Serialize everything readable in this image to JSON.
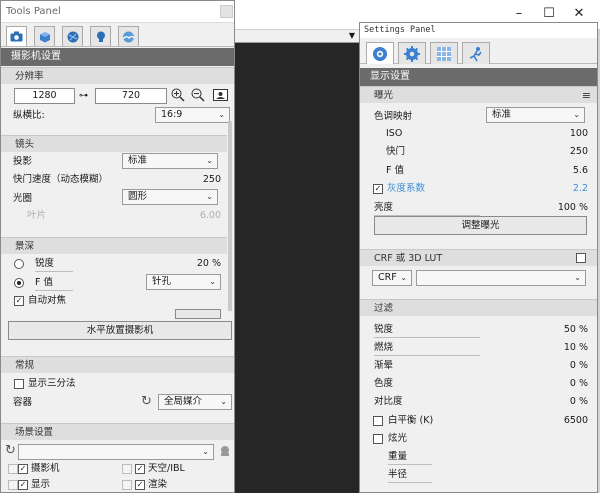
{
  "left_panel": {
    "title": "Tools Panel",
    "section_title": "摄影机设置",
    "resolution": {
      "heading": "分辨率",
      "width": "1280",
      "height": "720",
      "aspect_label": "纵横比:",
      "aspect_value": "16:9"
    },
    "lens": {
      "heading": "镜头",
      "projection_label": "投影",
      "projection_value": "标准",
      "shutter_label": "快门速度（动态模糊）",
      "shutter_value": "250",
      "aperture_label": "光圈",
      "aperture_value": "圆形",
      "blades_label": "叶片",
      "blades_value": "6.00"
    },
    "dof": {
      "heading": "景深",
      "sharpness_label": "锐度",
      "sharpness_value": "20 %",
      "fstop_label": "F 值",
      "fstop_value": "针孔",
      "autofocus_label": "自动对焦",
      "level_button": "水平放置摄影机"
    },
    "general": {
      "heading": "常规",
      "thirds_label": "显示三分法",
      "container_label": "容器",
      "container_value": "全局媒介"
    },
    "scene": {
      "heading": "场景设置",
      "camera_label": "摄影机",
      "sky_label": "天空/IBL",
      "display_label": "显示",
      "render_label": "渲染"
    }
  },
  "right_panel": {
    "title": "Settings Panel",
    "section_title": "显示设置",
    "exposure": {
      "heading": "曝光",
      "tonemap_label": "色调映射",
      "tonemap_value": "标准",
      "iso_label": "ISO",
      "iso_value": "100",
      "shutter_label": "快门",
      "shutter_value": "250",
      "fstop_label": "F 值",
      "fstop_value": "5.6",
      "gamma_label": "灰度系数",
      "gamma_value": "2.2",
      "brightness_label": "亮度",
      "brightness_value": "100 %",
      "adjust_button": "调整曝光"
    },
    "crf": {
      "heading": "CRF 或 3D LUT",
      "select_value": "CRF"
    },
    "filter": {
      "heading": "过滤",
      "sharpness_label": "锐度",
      "sharpness_value": "50 %",
      "burn_label": "燃烧",
      "burn_value": "10 %",
      "vignette_label": "渐晕",
      "vignette_value": "0 %",
      "saturation_label": "色度",
      "saturation_value": "0 %",
      "contrast_label": "对比度",
      "contrast_value": "0 %",
      "wb_label": "白平衡 (K)",
      "wb_value": "6500",
      "glare_label": "炫光",
      "intensity_label": "重量",
      "radius_label": "半径"
    }
  },
  "colors": {
    "section_bg": "#6b6b6b",
    "accent_blue": "#3b8fd9",
    "dark_viewport": "#262626"
  }
}
